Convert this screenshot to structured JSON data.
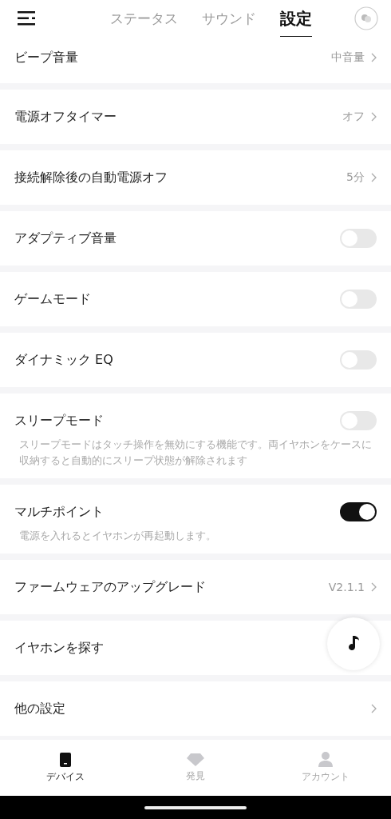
{
  "header": {
    "tabs": [
      {
        "label": "ステータス",
        "selected": false
      },
      {
        "label": "サウンド",
        "selected": false
      },
      {
        "label": "設定",
        "selected": true
      }
    ]
  },
  "settings": [
    {
      "kind": "value",
      "label": "ビープ音量",
      "value": "中音量"
    },
    {
      "kind": "value",
      "label": "電源オフタイマー",
      "value": "オフ"
    },
    {
      "kind": "value",
      "label": "接続解除後の自動電源オフ",
      "value": "5分"
    },
    {
      "kind": "toggle",
      "label": "アダプティブ音量",
      "on": false
    },
    {
      "kind": "toggle",
      "label": "ゲームモード",
      "on": false
    },
    {
      "kind": "toggle",
      "label": "ダイナミック EQ",
      "on": false
    },
    {
      "kind": "toggle",
      "label": "スリープモード",
      "on": false,
      "description": "スリープモードはタッチ操作を無効にする機能です。両イヤホンをケースに収納すると自動的にスリープ状態が解除されます"
    },
    {
      "kind": "toggle",
      "label": "マルチポイント",
      "on": true,
      "description": "電源を入れるとイヤホンが再起動します。"
    },
    {
      "kind": "value",
      "label": "ファームウェアのアップグレード",
      "value": "V2.1.1"
    },
    {
      "kind": "plain",
      "label": "イヤホンを探す"
    },
    {
      "kind": "link",
      "label": "他の設定"
    }
  ],
  "bottom_nav": [
    {
      "label": "デバイス",
      "selected": true
    },
    {
      "label": "発見",
      "selected": false
    },
    {
      "label": "アカウント",
      "selected": false
    }
  ]
}
